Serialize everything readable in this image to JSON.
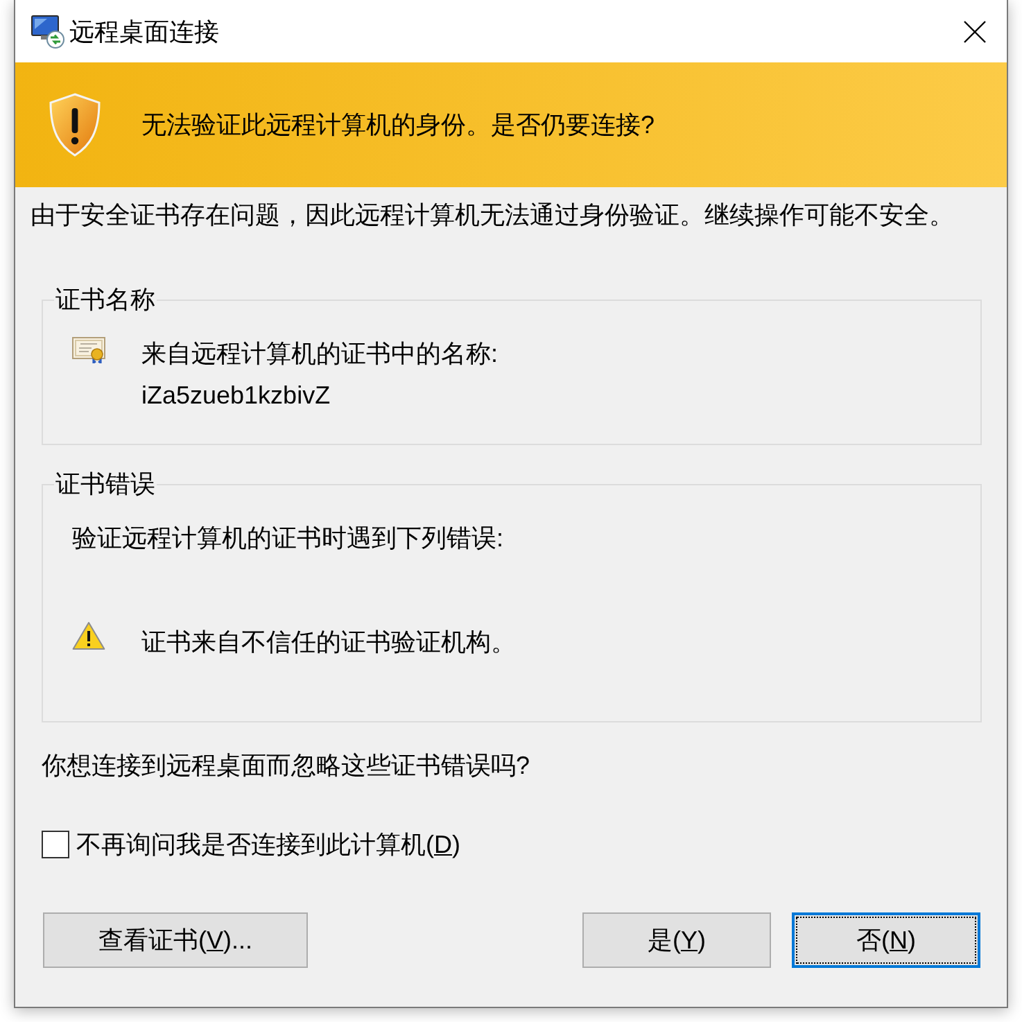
{
  "window": {
    "title": "远程桌面连接"
  },
  "banner": {
    "message": "无法验证此远程计算机的身份。是否仍要连接?"
  },
  "description": "由于安全证书存在问题，因此远程计算机无法通过身份验证。继续操作可能不安全。",
  "certificate_name": {
    "title": "证书名称",
    "label": "来自远程计算机的证书中的名称:",
    "value": "iZa5zueb1kzbivZ"
  },
  "certificate_errors": {
    "title": "证书错误",
    "intro": "验证远程计算机的证书时遇到下列错误:",
    "errors": [
      "证书来自不信任的证书验证机构。"
    ]
  },
  "question": "你想连接到远程桌面而忽略这些证书错误吗?",
  "dont_ask": {
    "label_before": "不再询问我是否连接到此计算机(",
    "access_key": "D",
    "label_after": ")",
    "checked": false
  },
  "buttons": [
    {
      "label_before": "查看证书(",
      "access_key": "V",
      "label_after": ")...",
      "focused": false
    },
    {
      "label_before": "是(",
      "access_key": "Y",
      "label_after": ")",
      "focused": false
    },
    {
      "label_before": "否(",
      "access_key": "N",
      "label_after": ")",
      "focused": true
    }
  ]
}
